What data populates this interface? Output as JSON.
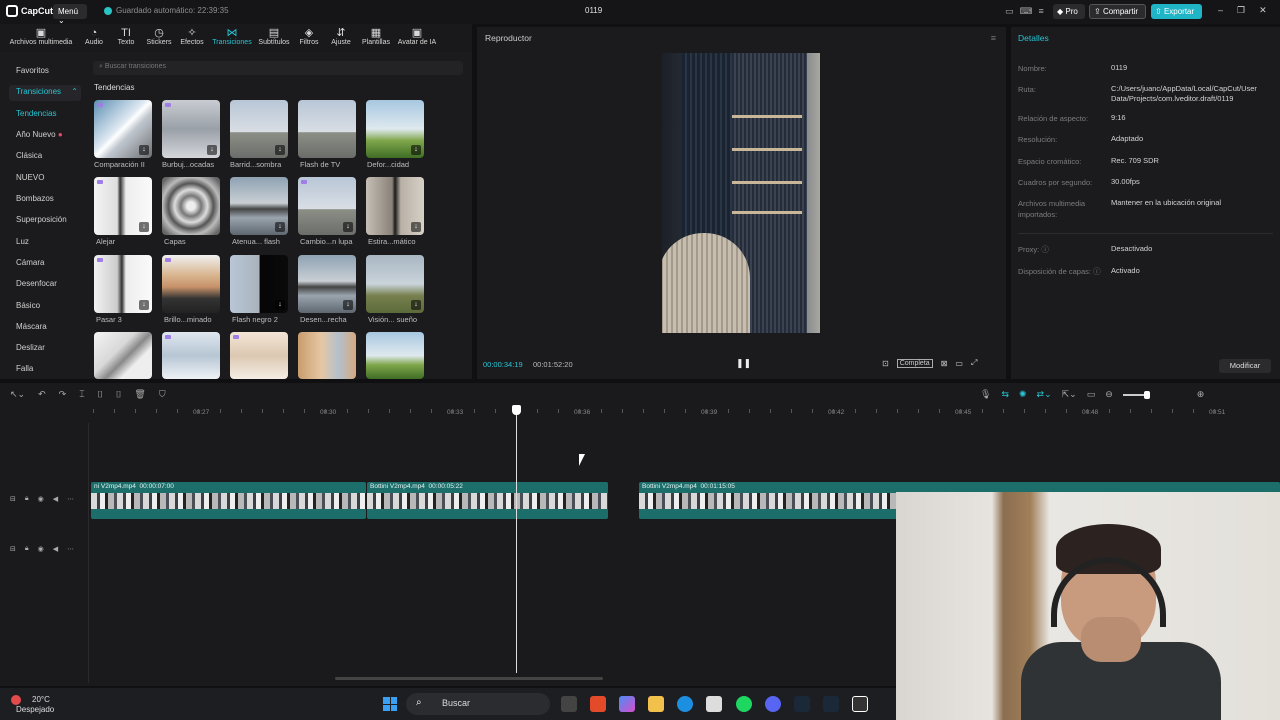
{
  "titlebar": {
    "logo": "CapCut",
    "menu": "Menú",
    "autosave": "Guardado automático: 22:39:35",
    "title": "0119",
    "pro": "Pro",
    "share": "Compartir",
    "export": "Exportar"
  },
  "toolbar": [
    {
      "label": "Archivos multimedia",
      "icon": "media-icon"
    },
    {
      "label": "Audio",
      "icon": "audio-icon"
    },
    {
      "label": "Texto",
      "icon": "text-icon"
    },
    {
      "label": "Stickers",
      "icon": "sticker-icon"
    },
    {
      "label": "Efectos",
      "icon": "effects-icon"
    },
    {
      "label": "Transiciones",
      "icon": "transitions-icon"
    },
    {
      "label": "Subtítulos",
      "icon": "subtitles-icon"
    },
    {
      "label": "Filtros",
      "icon": "filters-icon"
    },
    {
      "label": "Ajuste",
      "icon": "adjust-icon"
    },
    {
      "label": "Plantillas",
      "icon": "templates-icon"
    },
    {
      "label": "Avatar de IA",
      "icon": "ai-avatar-icon"
    }
  ],
  "sidebar": {
    "favorites": "Favoritos",
    "transitions": "Transiciones",
    "items": [
      "Tendencias",
      "Año Nuevo",
      "Clásica",
      "NUEVO",
      "Bombazos",
      "Superposición",
      "Luz",
      "Cámara",
      "Desenfocar",
      "Básico",
      "Máscara",
      "Deslizar",
      "Falla"
    ]
  },
  "library": {
    "search_placeholder": "Buscar transiciones",
    "section": "Tendencias",
    "items": [
      "Comparación II",
      "Burbuj...ocadas",
      "Barrid...sombra",
      "Flash de TV",
      "Defor...cidad",
      "Alejar",
      "Capas",
      "Atenua... flash",
      "Cambio...n lupa",
      "Estira...mático",
      "Pasar 3",
      "Brillo...minado",
      "Flash negro 2",
      "Desen...recha",
      "Visión... sueño"
    ]
  },
  "player": {
    "title": "Reproductor",
    "current_time": "00:00:34:19",
    "total_time": "00:01:52:20",
    "complete": "Completa"
  },
  "details": {
    "title": "Detalles",
    "rows": [
      {
        "key": "Nombre:",
        "value": "0119"
      },
      {
        "key": "Ruta:",
        "value": "C:/Users/juanc/AppData/Local/CapCut/User Data/Projects/com.lveditor.draft/0119"
      },
      {
        "key": "Relación de aspecto:",
        "value": "9:16"
      },
      {
        "key": "Resolución:",
        "value": "Adaptado"
      },
      {
        "key": "Espacio cromático:",
        "value": "Rec. 709 SDR"
      },
      {
        "key": "Cuadros por segundo:",
        "value": "30.00fps"
      },
      {
        "key": "Archivos multimedia importados:",
        "value": "Mantener en la ubicación original"
      },
      {
        "key": "Proxy:",
        "value": "Desactivado"
      },
      {
        "key": "Disposición de capas:",
        "value": "Activado"
      }
    ],
    "modify": "Modificar"
  },
  "timeline": {
    "ruler": [
      "00:27",
      "00:30",
      "00:33",
      "00:36",
      "00:39",
      "00:42",
      "00:45",
      "00:48",
      "00:51"
    ],
    "clips": [
      {
        "name": "ni V2mp4.mp4",
        "duration": "00:00:07:00"
      },
      {
        "name": "Bottini V2mp4.mp4",
        "duration": "00:00:05:22"
      },
      {
        "name": "Bottini V2mp4.mp4",
        "duration": "00:01:15:05"
      }
    ]
  },
  "taskbar": {
    "temp": "20°C",
    "weather": "Despejado",
    "search": "Buscar"
  }
}
